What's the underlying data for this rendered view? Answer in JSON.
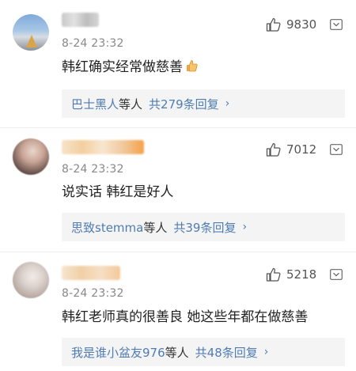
{
  "comments": [
    {
      "time": "8-24 23:32",
      "likes": "9830",
      "text": "韩红确实经常做慈善",
      "reply_names": "巴士黑人",
      "reply_suffix": "等人",
      "reply_count": "共279条回复",
      "reply_chevron": "›"
    },
    {
      "time": "8-24 23:32",
      "likes": "7012",
      "text": "说实话 韩红是好人",
      "reply_names": "思致stemma",
      "reply_suffix": "等人",
      "reply_count": "共39条回复",
      "reply_chevron": "›"
    },
    {
      "time": "8-24 23:32",
      "likes": "5218",
      "text": "韩红老师真的很善良 她这些年都在做慈善",
      "reply_names": "我是谁小盆友976",
      "reply_suffix": "等人",
      "reply_count": "共48条回复",
      "reply_chevron": "›"
    }
  ],
  "icons": {
    "like": "thumbs-up-icon",
    "more": "chevron-down-box-icon",
    "emoji": "thumbs-up-emoji"
  },
  "colors": {
    "link": "#4f7cb2",
    "text": "#222222",
    "meta": "#888888",
    "reply_bg": "#f4f4f4"
  }
}
